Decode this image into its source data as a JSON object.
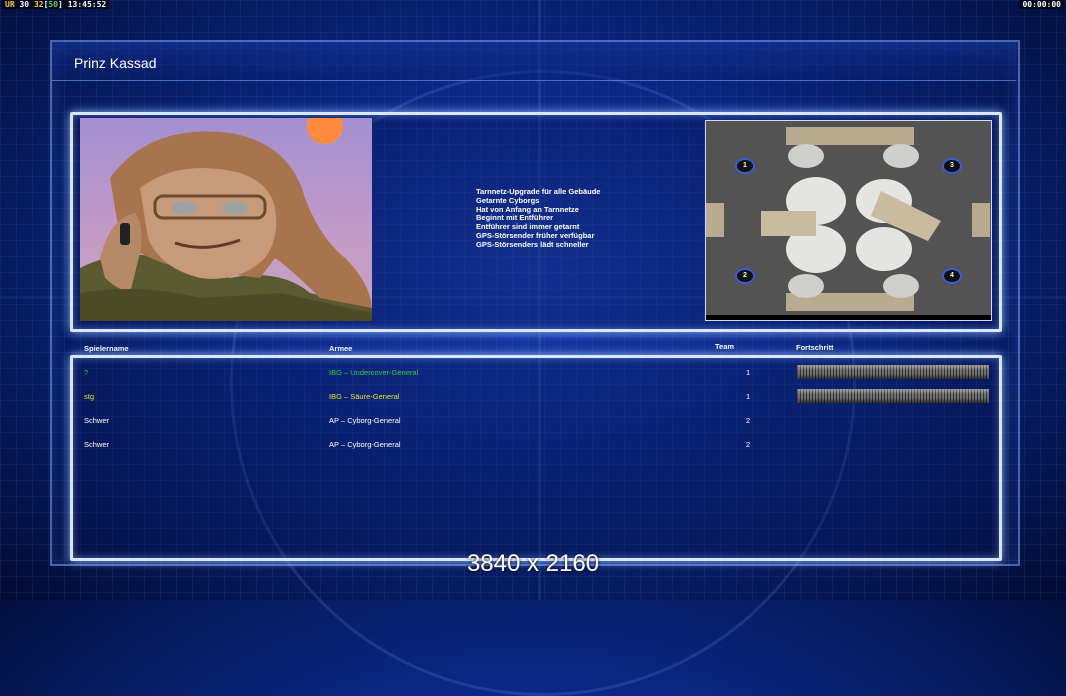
{
  "hud": {
    "left_prefix": "UR",
    "left_fps": "30",
    "left_n32": "32",
    "left_n50": "50",
    "left_time": "13:45:52",
    "right_time": "00:00:00"
  },
  "general": {
    "name": "Prinz Kassad",
    "traits": [
      "Tarnnetz-Upgrade für alle Gebäude",
      "Getarnte Cyborgs",
      "Hat von Anfang an Tarnnetze",
      "Beginnt mit Entführer",
      "Entführer sind immer getarnt",
      "GPS-Störsender früher verfügbar",
      "GPS-Störsenders lädt schneller"
    ]
  },
  "minimap": {
    "start_positions": [
      "1",
      "2",
      "3",
      "4"
    ]
  },
  "table": {
    "headers": {
      "player": "Spielername",
      "army": "Armee",
      "team": "Team",
      "progress": "Fortschritt"
    },
    "rows": [
      {
        "player": "?",
        "army": "IBG – Undercover-General",
        "team": "1",
        "color": "#2fd02f",
        "progress": 1.0,
        "show_progress": true
      },
      {
        "player": "stg",
        "army": "IBG – Säure-General",
        "team": "1",
        "color": "#e6e62a",
        "progress": 1.0,
        "show_progress": true
      },
      {
        "player": "Schwer",
        "army": "AP – Cyborg-General",
        "team": "2",
        "color": "#ffffff",
        "progress": 0,
        "show_progress": false
      },
      {
        "player": "Schwer",
        "army": "AP – Cyborg-General",
        "team": "2",
        "color": "#ffffff",
        "progress": 0,
        "show_progress": false
      }
    ]
  },
  "resolution_label": "3840 x 2160"
}
